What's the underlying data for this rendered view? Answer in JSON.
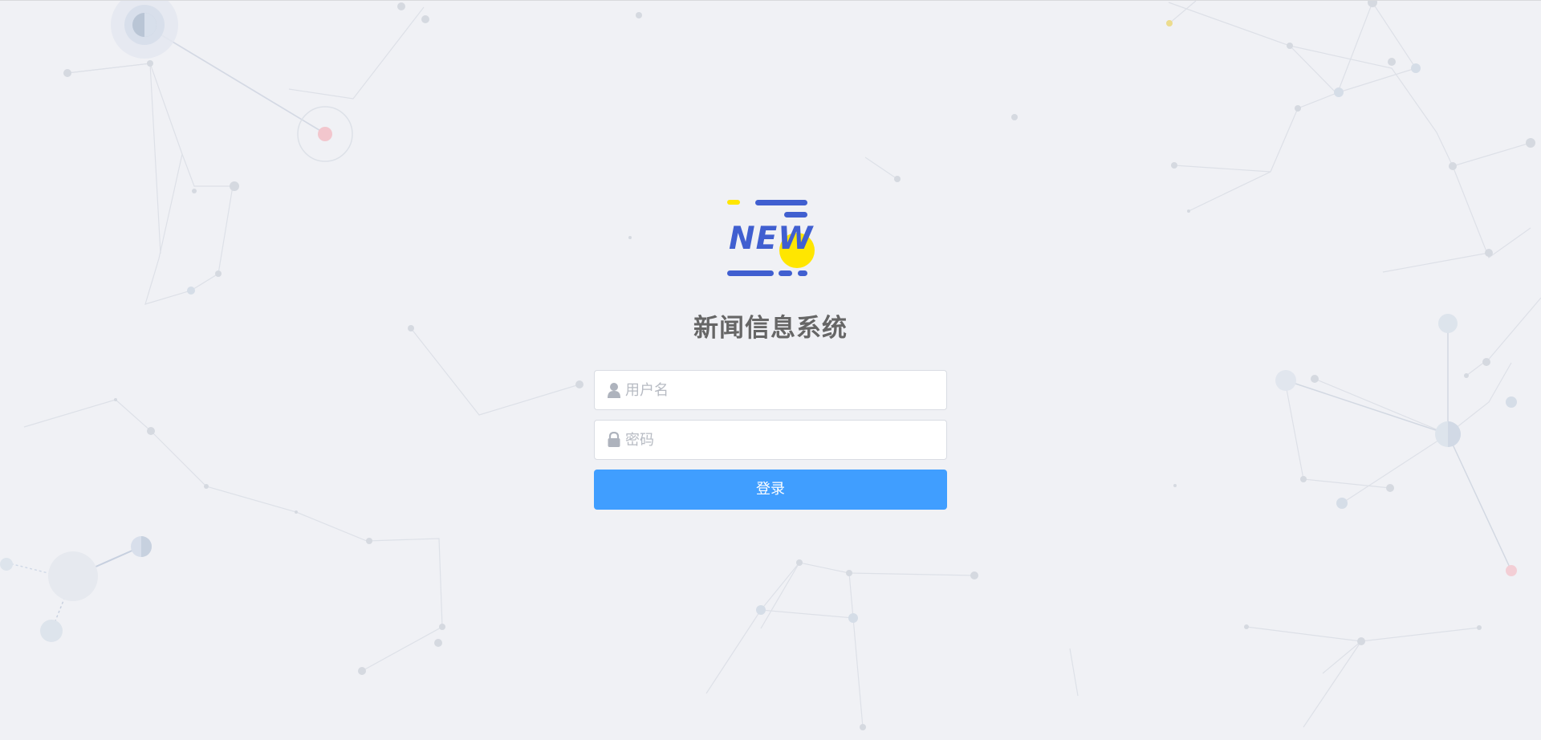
{
  "app": {
    "logo_text": "NEW",
    "title": "新闻信息系统"
  },
  "login": {
    "username_placeholder": "用户名",
    "password_placeholder": "密码",
    "submit_label": "登录"
  },
  "icons": {
    "username": "user-icon",
    "password": "lock-icon"
  },
  "colors": {
    "background": "#f0f1f5",
    "brand_blue": "#405fd0",
    "brand_yellow": "#ffe600",
    "primary_button": "#409eff",
    "title_gray": "#666666",
    "placeholder_gray": "#b7bbc3"
  }
}
